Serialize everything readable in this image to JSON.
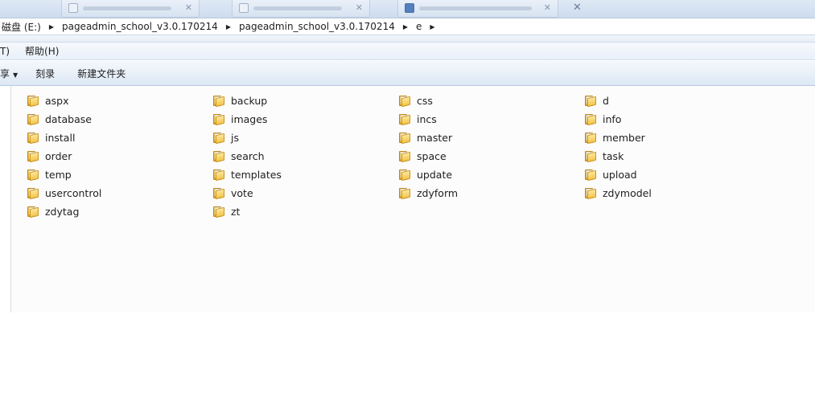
{
  "address": {
    "crumbs": [
      "磁盘 (E:)",
      "pageadmin_school_v3.0.170214",
      "pageadmin_school_v3.0.170214",
      "e"
    ]
  },
  "menu": {
    "items": [
      "T)",
      "帮助(H)"
    ]
  },
  "commands": {
    "share_label": "享",
    "burn_label": "刻录",
    "new_folder_label": "新建文件夹"
  },
  "folders": [
    "aspx",
    "backup",
    "css",
    "d",
    "database",
    "images",
    "incs",
    "info",
    "install",
    "js",
    "master",
    "member",
    "order",
    "search",
    "space",
    "task",
    "temp",
    "templates",
    "update",
    "upload",
    "usercontrol",
    "vote",
    "zdyform",
    "zdymodel",
    "zdytag",
    "zt"
  ],
  "colors": {
    "folder": "#f3c54c",
    "chrome": "#dde8f4",
    "pane": "#fcfcfc"
  }
}
